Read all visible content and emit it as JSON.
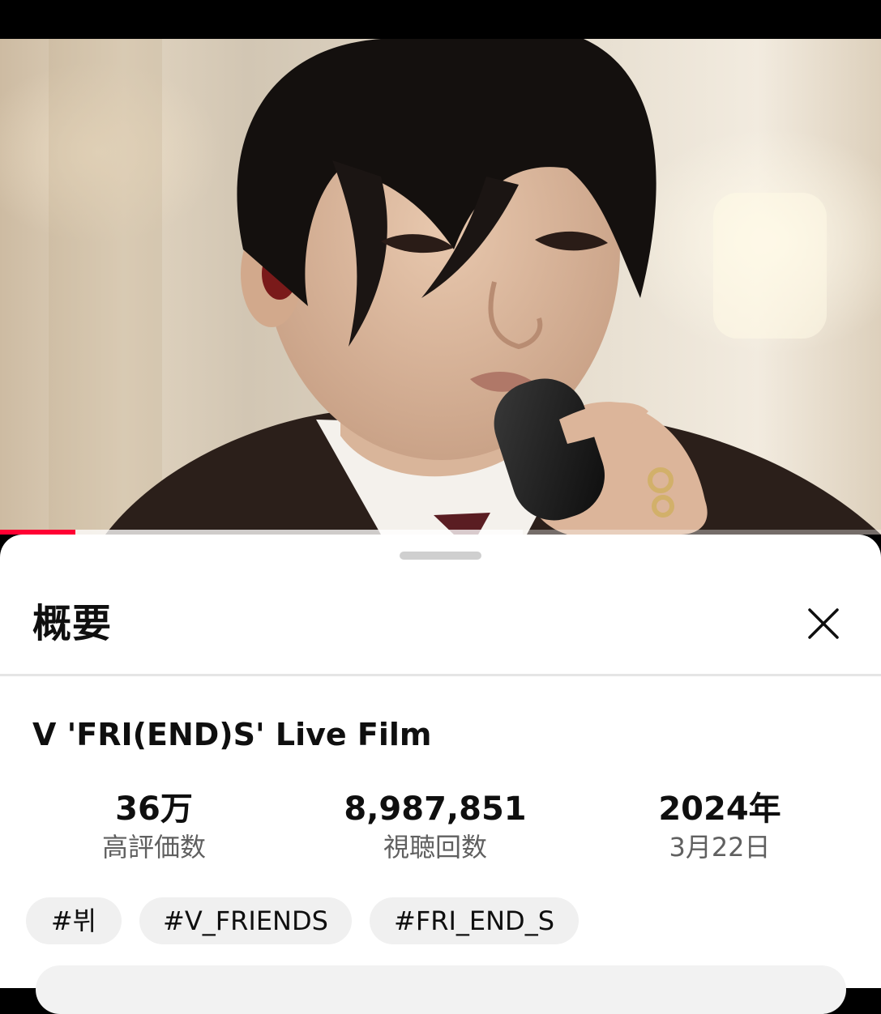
{
  "sheet": {
    "title": "概要",
    "close_icon": "close-icon"
  },
  "video": {
    "title": "V 'FRI(END)S' Live Film",
    "progress": {
      "played_fraction": 0.086,
      "buffered_fraction": 0.593
    }
  },
  "stats": {
    "likes": {
      "value": "36万",
      "label": "高評価数"
    },
    "views": {
      "value": "8,987,851",
      "label": "視聴回数"
    },
    "date": {
      "value": "2024年",
      "label": "3月22日"
    }
  },
  "tags": [
    "#뷔",
    "#V_FRIENDS",
    "#FRI_END_S"
  ],
  "colors": {
    "accent": "#ff0033",
    "sheet_bg": "#ffffff",
    "chip_bg": "#f0f0f0",
    "secondary_text": "#606060"
  }
}
